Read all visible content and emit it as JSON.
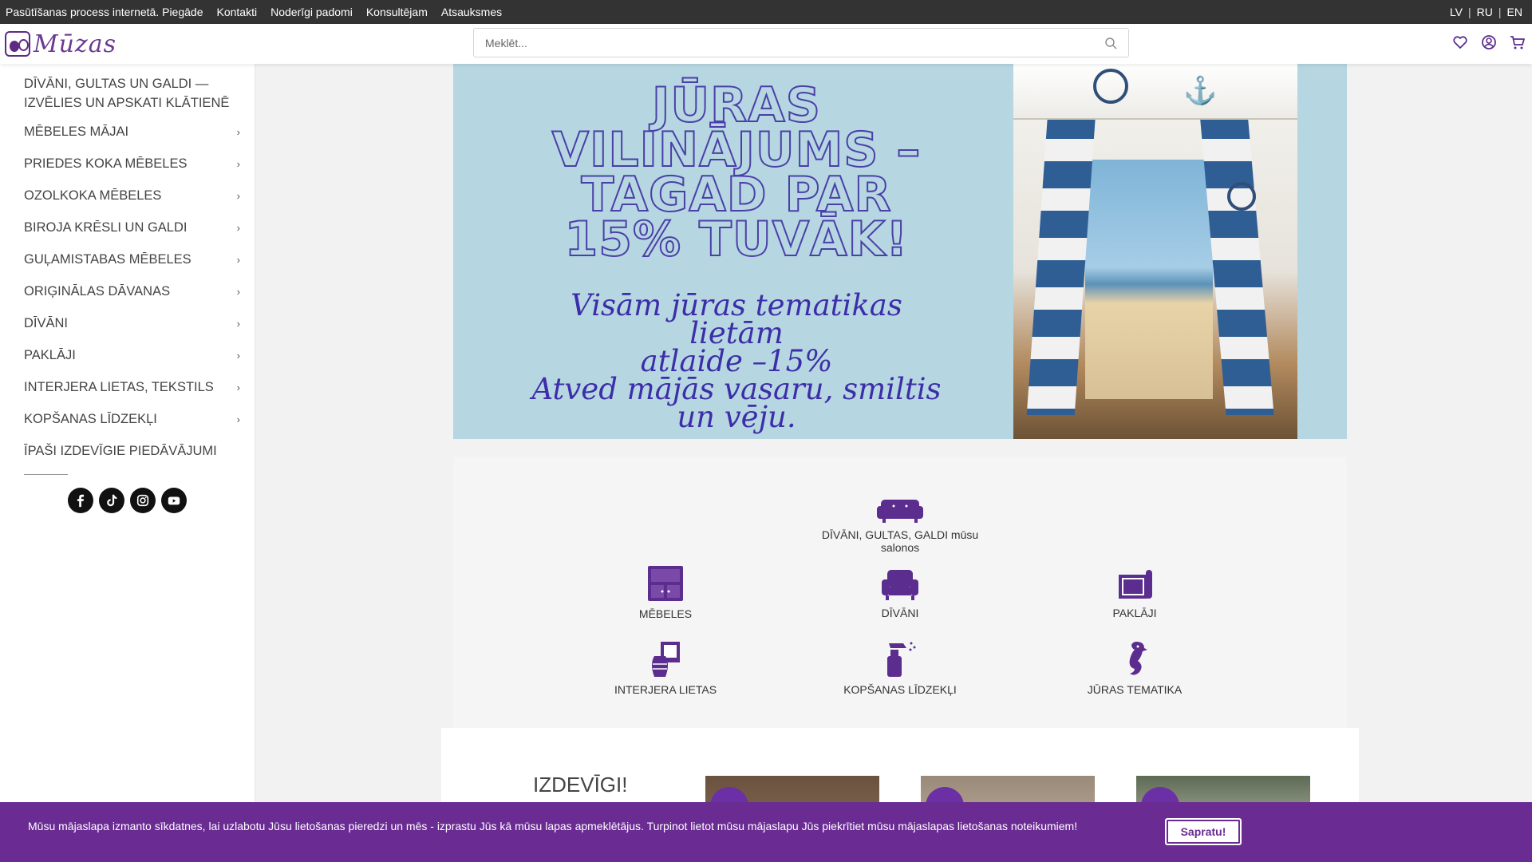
{
  "topbar": {
    "links": [
      "Pasūtīšanas process internetā. Piegāde",
      "Kontakti",
      "Noderīgi padomi",
      "Konsultējam",
      "Atsauksmes"
    ],
    "languages": [
      "LV",
      "RU",
      "EN"
    ]
  },
  "header": {
    "logo_text": "Mūzas",
    "search_placeholder": "Meklēt...",
    "icons": [
      "heart-icon",
      "user-icon",
      "cart-icon"
    ]
  },
  "sidebar": {
    "heading": "DĪVĀNI, GULTAS UN GALDI — IZVĒLIES UN APSKATI KLĀTIENĒ",
    "items": [
      {
        "label": "MĒBELES MĀJAI",
        "has_chevron": true
      },
      {
        "label": "PRIEDES KOKA MĒBELES",
        "has_chevron": true
      },
      {
        "label": "OZOLKOKA MĒBELES",
        "has_chevron": true
      },
      {
        "label": "BIROJA KRĒSLI UN GALDI",
        "has_chevron": true
      },
      {
        "label": "GUĻAMISTABAS MĒBELES",
        "has_chevron": true
      },
      {
        "label": "ORIĢINĀLAS DĀVANAS",
        "has_chevron": true
      },
      {
        "label": "DĪVĀNI",
        "has_chevron": true
      },
      {
        "label": "PAKLĀJI",
        "has_chevron": true
      },
      {
        "label": "INTERJERA LIETAS, TEKSTILS",
        "has_chevron": true
      },
      {
        "label": "KOPŠANAS LĪDZEKĻI",
        "has_chevron": true
      },
      {
        "label": "ĪPAŠI IZDEVĪGIE PIEDĀVĀJUMI",
        "has_chevron": false
      }
    ],
    "chevron": "›",
    "socials": [
      "facebook-icon",
      "tiktok-icon",
      "instagram-icon",
      "youtube-icon"
    ]
  },
  "banner": {
    "title": "JŪRAS VILINĀJUMS – TAGAD PAR 15% TUVĀK!",
    "subtitle_line1": "Visām jūras tematikas lietām",
    "subtitle_line2": "atlaide –15%",
    "subtitle_line3": "Atved mājās vasaru, smiltis",
    "subtitle_line4": "un vēju."
  },
  "categories": {
    "featured": {
      "label": "DĪVĀNI, GULTAS, GALDI mūsu salonos",
      "icon": "sofa-icon"
    },
    "items": [
      {
        "label": "MĒBELES",
        "icon": "cabinet-icon"
      },
      {
        "label": "DĪVĀNI",
        "icon": "armchair-icon"
      },
      {
        "label": "PAKLĀJI",
        "icon": "rug-icon"
      },
      {
        "label": "INTERJERA LIETAS",
        "icon": "vase-icon"
      },
      {
        "label": "KOPŠANAS LĪDZEKĻI",
        "icon": "spray-bottle-icon"
      },
      {
        "label": "JŪRAS TEMATIKA",
        "icon": "seahorse-icon"
      }
    ]
  },
  "deals": {
    "title": "IZDEVĪGI!"
  },
  "cookie": {
    "text": "Mūsu mājaslapa izmanto sīkdatnes, lai uzlabotu Jūsu lietošanas pieredzi un mēs - izprastu Jūs kā mūsu lapas apmeklētājus. Turpinot lietot mūsu mājaslapu Jūs piekrītiet mūsu mājaslapas lietošanas noteikumiem!",
    "button": "Sapratu!"
  },
  "colors": {
    "topbar": "#333333",
    "brand_purple": "#6a2b93",
    "icon_purple": "#5b2d8e",
    "banner_bg": "#b6d6e1",
    "banner_text": "#3c2ea8"
  }
}
